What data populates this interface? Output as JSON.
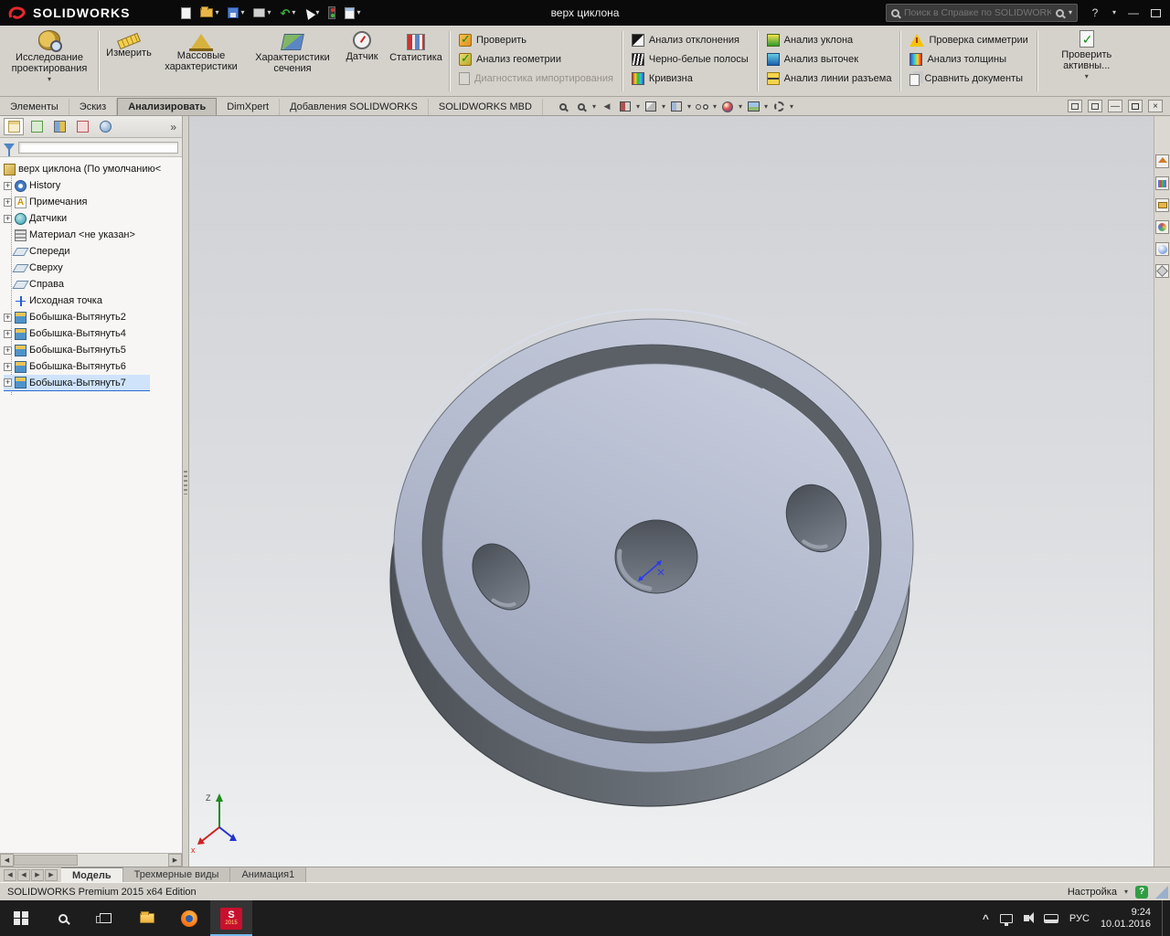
{
  "glyphs": {
    "dropdown": "▾",
    "chevrons": "»",
    "plus": "+",
    "left": "◀",
    "right": "▶",
    "minimize": "—",
    "close": "×",
    "help": "?",
    "caret": "^",
    "check": "✓",
    "letter_a": "A",
    "undo": "↶"
  },
  "colors": {
    "accent_red": "#c8102e",
    "model_face": "#b3bacd",
    "model_side": "#585d64",
    "selection_blue": "#2a6cd0"
  },
  "titlebar": {
    "app_name": "SOLIDWORKS",
    "document_title": "верх циклона",
    "search_placeholder": "Поиск в Справке по SOLIDWORKS"
  },
  "ribbon": {
    "big_left": {
      "line1": "Исследование",
      "line2": "проектирования"
    },
    "tools": [
      "Измерить",
      "Массовые характеристики",
      "Характеристики сечения",
      "Датчик",
      "Статистика"
    ],
    "checks": [
      "Проверить",
      "Анализ геометрии",
      "Диагностика импортирования"
    ],
    "col_a": [
      "Анализ отклонения",
      "Черно-белые полосы",
      "Кривизна"
    ],
    "col_b": [
      "Анализ уклона",
      "Анализ выточек",
      "Анализ линии разъема"
    ],
    "col_c": [
      "Проверка симметрии",
      "Анализ толщины",
      "Сравнить документы"
    ],
    "big_right": {
      "line1": "Проверить",
      "line2": "активны..."
    }
  },
  "command_tabs": {
    "items": [
      "Элементы",
      "Эскиз",
      "Анализировать",
      "DimXpert",
      "Добавления SOLIDWORKS",
      "SOLIDWORKS MBD"
    ],
    "active": "Анализировать"
  },
  "feature_tree": {
    "root": "верх циклона  (По умолчанию<",
    "items": [
      {
        "label": "History",
        "icon": "history",
        "expandable": true
      },
      {
        "label": "Примечания",
        "icon": "annotations",
        "expandable": true
      },
      {
        "label": "Датчики",
        "icon": "sensors",
        "expandable": true
      },
      {
        "label": "Материал <не указан>",
        "icon": "material",
        "expandable": false
      },
      {
        "label": "Спереди",
        "icon": "plane",
        "expandable": false
      },
      {
        "label": "Сверху",
        "icon": "plane",
        "expandable": false
      },
      {
        "label": "Справа",
        "icon": "plane",
        "expandable": false
      },
      {
        "label": "Исходная точка",
        "icon": "origin",
        "expandable": false
      },
      {
        "label": "Бобышка-Вытянуть2",
        "icon": "boss-extrude",
        "expandable": true
      },
      {
        "label": "Бобышка-Вытянуть4",
        "icon": "boss-extrude",
        "expandable": true
      },
      {
        "label": "Бобышка-Вытянуть5",
        "icon": "boss-extrude",
        "expandable": true
      },
      {
        "label": "Бобышка-Вытянуть6",
        "icon": "boss-extrude",
        "expandable": true
      },
      {
        "label": "Бобышка-Вытянуть7",
        "icon": "boss-extrude",
        "expandable": true,
        "selected": true
      }
    ]
  },
  "viewport": {
    "triad": {
      "up_label": "Z",
      "x_label": "x"
    }
  },
  "sheet_tabs": {
    "items": [
      "Модель",
      "Трехмерные виды",
      "Анимация1"
    ],
    "active": "Модель"
  },
  "status_bar": {
    "edition": "SOLIDWORKS Premium 2015 x64 Edition",
    "right_label": "Настройка"
  },
  "taskbar": {
    "language": "РУС",
    "time": "9:24",
    "date": "10.01.2016",
    "sw_icon_letter": "S",
    "sw_icon_year": "2015"
  }
}
